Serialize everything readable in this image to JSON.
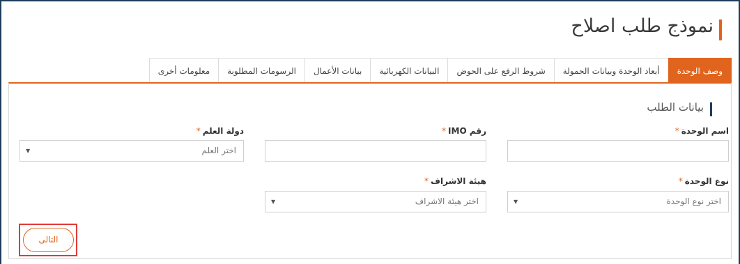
{
  "page": {
    "title": "نموذج طلب اصلاح"
  },
  "tabs": [
    {
      "label": "وصف الوحدة",
      "active": true
    },
    {
      "label": "أبعاد الوحدة وبيانات الحمولة",
      "active": false
    },
    {
      "label": "شروط الرفع على الحوض",
      "active": false
    },
    {
      "label": "البيانات الكهربائية",
      "active": false
    },
    {
      "label": "بيانات الأعمال",
      "active": false
    },
    {
      "label": "الرسومات المطلوبة",
      "active": false
    },
    {
      "label": "معلومات أخرى",
      "active": false
    }
  ],
  "section": {
    "title": "بيانات الطلب"
  },
  "form": {
    "required_mark": "*",
    "unit_name": {
      "label": "اسم الوحدة",
      "value": ""
    },
    "imo_number": {
      "label": "رقم IMO",
      "value": ""
    },
    "flag_country": {
      "label": "دولة العلم",
      "placeholder": "اختر العلم"
    },
    "unit_type": {
      "label": "نوع الوحدة",
      "placeholder": "اختر نوع الوحدة"
    },
    "supervision_body": {
      "label": "هيئة الاشراف",
      "placeholder": "اختر هيئة الاشراف"
    },
    "dropdown_arrow": "▼"
  },
  "actions": {
    "next_label": "التالى"
  },
  "colors": {
    "accent": "#e0641d",
    "navy": "#1f3d5c",
    "highlight": "#e03a3a"
  }
}
